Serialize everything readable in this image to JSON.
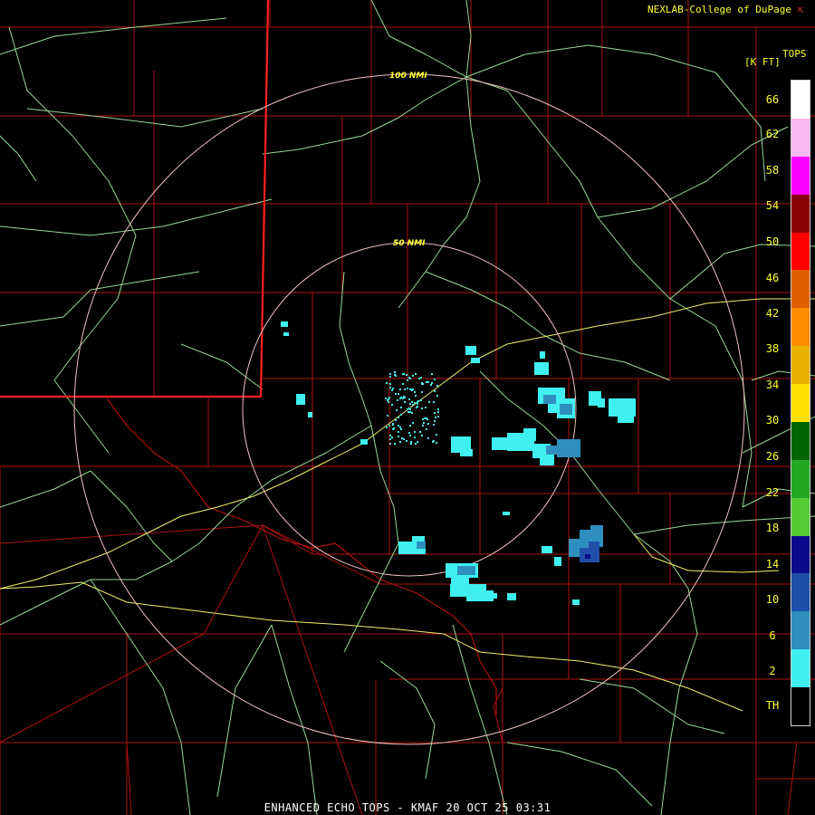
{
  "header": {
    "credit": "NEXLAB-College of DuPage",
    "credit_icon": "arrow-cursor-icon"
  },
  "legend": {
    "title": "TOPS",
    "units": "[K FT]",
    "colors": [
      "#ffffff",
      "#f7b8ef",
      "#ff00ff",
      "#8b0000",
      "#ff0000",
      "#e06000",
      "#ff8c00",
      "#e8b000",
      "#ffe000",
      "#006400",
      "#22a822",
      "#55cc33",
      "#0a0a8a",
      "#1f4fa8",
      "#2e8fbf",
      "#40f0f0",
      "#000000"
    ],
    "labels": [
      "66",
      "62",
      "58",
      "54",
      "50",
      "46",
      "42",
      "38",
      "34",
      "30",
      "26",
      "22",
      "18",
      "14",
      "10",
      "6",
      "2",
      "TH"
    ]
  },
  "rings": [
    {
      "label": "100 NMI"
    },
    {
      "label": "50 NMI"
    }
  ],
  "footer": {
    "product": "ENHANCED ECHO TOPS - KMAF 20 OCT 25 03:31"
  },
  "palette": {
    "county_lines": "#b01010",
    "state_line": "#ff2020",
    "highways": "#98d898",
    "interstates": "#f0f06a",
    "range_rings": "#f0c0c0"
  }
}
